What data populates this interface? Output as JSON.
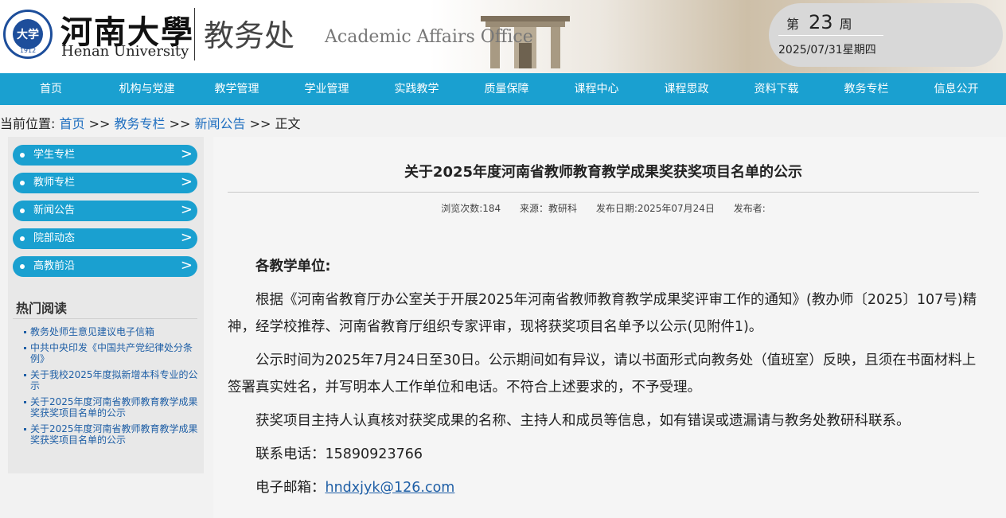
{
  "header": {
    "logo_year": "1912",
    "logo_mark": "大学",
    "school_cn": "河南大學",
    "school_en": "Henan University",
    "dept_cn": "教务处",
    "dept_en": "Academic Affairs Office",
    "week_prefix": "第",
    "week_number": "23",
    "week_suffix": "周",
    "date": "2025/07/31星期四"
  },
  "nav": {
    "items": [
      "首页",
      "机构与党建",
      "教学管理",
      "学业管理",
      "实践教学",
      "质量保障",
      "课程中心",
      "课程思政",
      "资料下载",
      "教务专栏",
      "信息公开"
    ]
  },
  "breadcrumb": {
    "prefix": "当前位置:",
    "home": "首页",
    "sep": ">>",
    "column": "教务专栏",
    "section": "新闻公告",
    "current": "正文"
  },
  "sidebar": {
    "menu": [
      "学生专栏",
      "教师专栏",
      "新闻公告",
      "院部动态",
      "高教前沿"
    ],
    "arrow": ">",
    "hot_title": "热门阅读",
    "hot_items": [
      "教务处师生意见建议电子信箱",
      "中共中央印发《中国共产党纪律处分条例》",
      "关于我校2025年度拟新增本科专业的公示",
      "关于2025年度河南省教师教育教学成果奖获奖项目名单的公示",
      "关于2025年度河南省教师教育教学成果奖获奖项目名单的公示"
    ]
  },
  "article": {
    "title": "关于2025年度河南省教师教育教学成果奖获奖项目名单的公示",
    "views": "浏览次数:184",
    "source": "来源：教研科",
    "date": "发布日期:2025年07月24日",
    "publisher": "发布者:",
    "salutation": "各教学单位:",
    "para1": "根据《河南省教育厅办公室关于开展2025年河南省教师教育教学成果奖评审工作的通知》(教办师〔2025〕107号)精神，经学校推荐、河南省教育厅组织专家评审，现将获奖项目名单予以公示(见附件1)。",
    "para2": "公示时间为2025年7月24日至30日。公示期间如有异议，请以书面形式向教务处（值班室）反映，且须在书面材料上签署真实姓名，并写明本人工作单位和电话。不符合上述要求的，不予受理。",
    "para3": "获奖项目主持人认真核对获奖成果的名称、主持人和成员等信息，如有错误或遗漏请与教务处教研科联系。",
    "phone_label": "联系电话：",
    "phone": "15890923766",
    "email_label": "电子邮箱：",
    "email": "hndxjyk@126.com"
  },
  "colors": {
    "nav_bg": "#1aa0d0",
    "link": "#1f6fc0",
    "logo": "#1d4e9b"
  }
}
